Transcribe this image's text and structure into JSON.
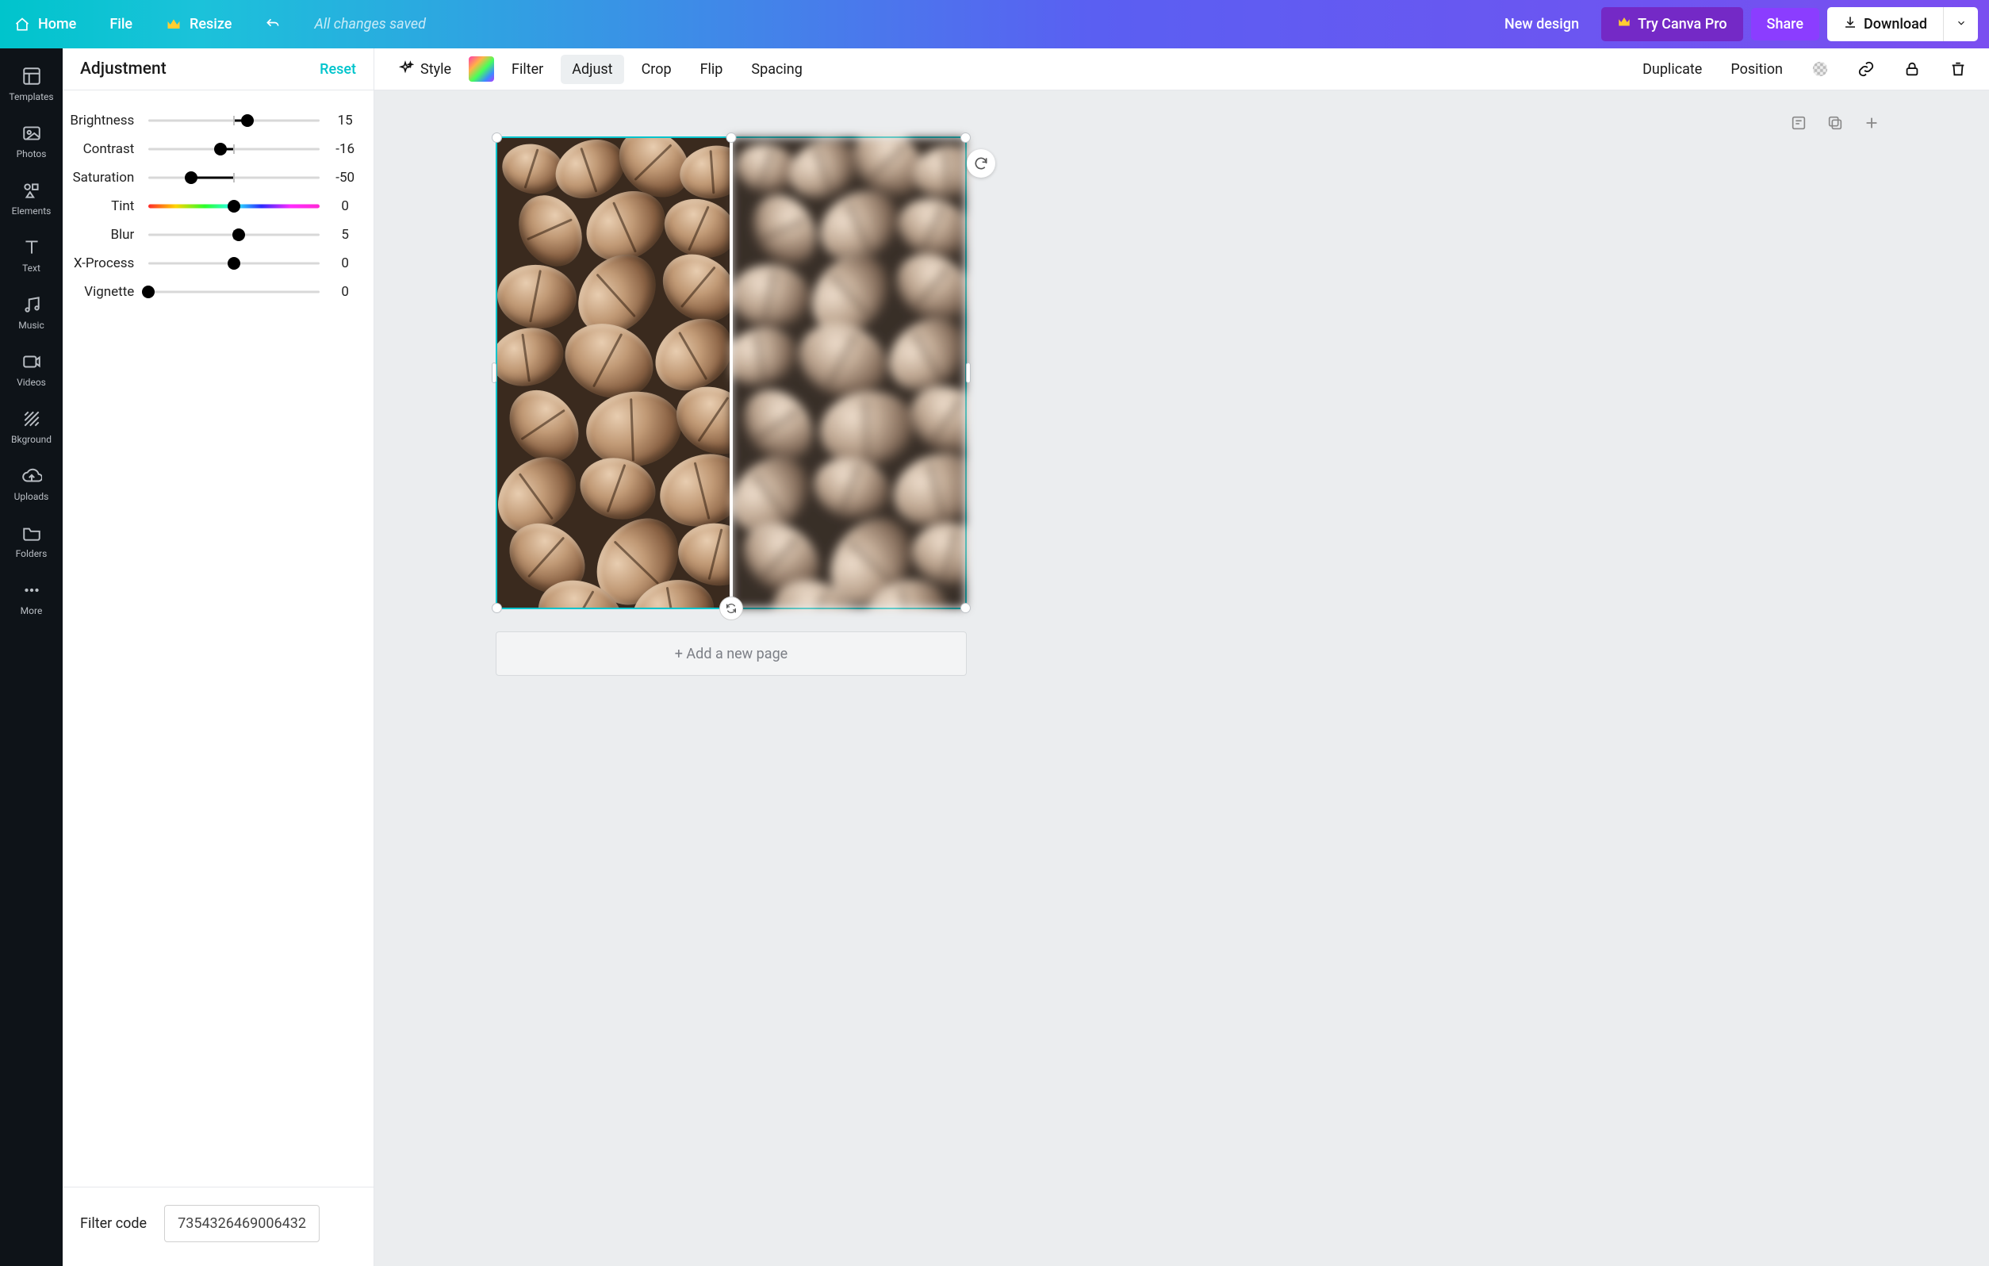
{
  "topbar": {
    "home": "Home",
    "file": "File",
    "resize": "Resize",
    "saved_status": "All changes saved",
    "new_design": "New design",
    "try_pro": "Try Canva Pro",
    "share": "Share",
    "download": "Download"
  },
  "leftnav": {
    "items": [
      "Templates",
      "Photos",
      "Elements",
      "Text",
      "Music",
      "Videos",
      "Bkground",
      "Uploads",
      "Folders",
      "More"
    ]
  },
  "panel": {
    "title": "Adjustment",
    "reset": "Reset",
    "sliders": [
      {
        "label": "Brightness",
        "value": 15,
        "min": -100,
        "max": 100,
        "centered": true
      },
      {
        "label": "Contrast",
        "value": -16,
        "min": -100,
        "max": 100,
        "centered": true
      },
      {
        "label": "Saturation",
        "value": -50,
        "min": -100,
        "max": 100,
        "centered": true
      },
      {
        "label": "Tint",
        "value": 0,
        "min": -100,
        "max": 100,
        "centered": true,
        "tint": true
      },
      {
        "label": "Blur",
        "value": 5,
        "min": -100,
        "max": 100,
        "centered": true
      },
      {
        "label": "X-Process",
        "value": 0,
        "min": -100,
        "max": 100,
        "centered": true
      },
      {
        "label": "Vignette",
        "value": 0,
        "min": 0,
        "max": 100,
        "centered": false
      }
    ],
    "filter_code_label": "Filter code",
    "filter_code_value": "7354326469006432"
  },
  "toolbar": {
    "style": "Style",
    "filter": "Filter",
    "adjust": "Adjust",
    "crop": "Crop",
    "flip": "Flip",
    "spacing": "Spacing",
    "duplicate": "Duplicate",
    "position": "Position"
  },
  "canvas": {
    "add_page": "+ Add a new page"
  }
}
